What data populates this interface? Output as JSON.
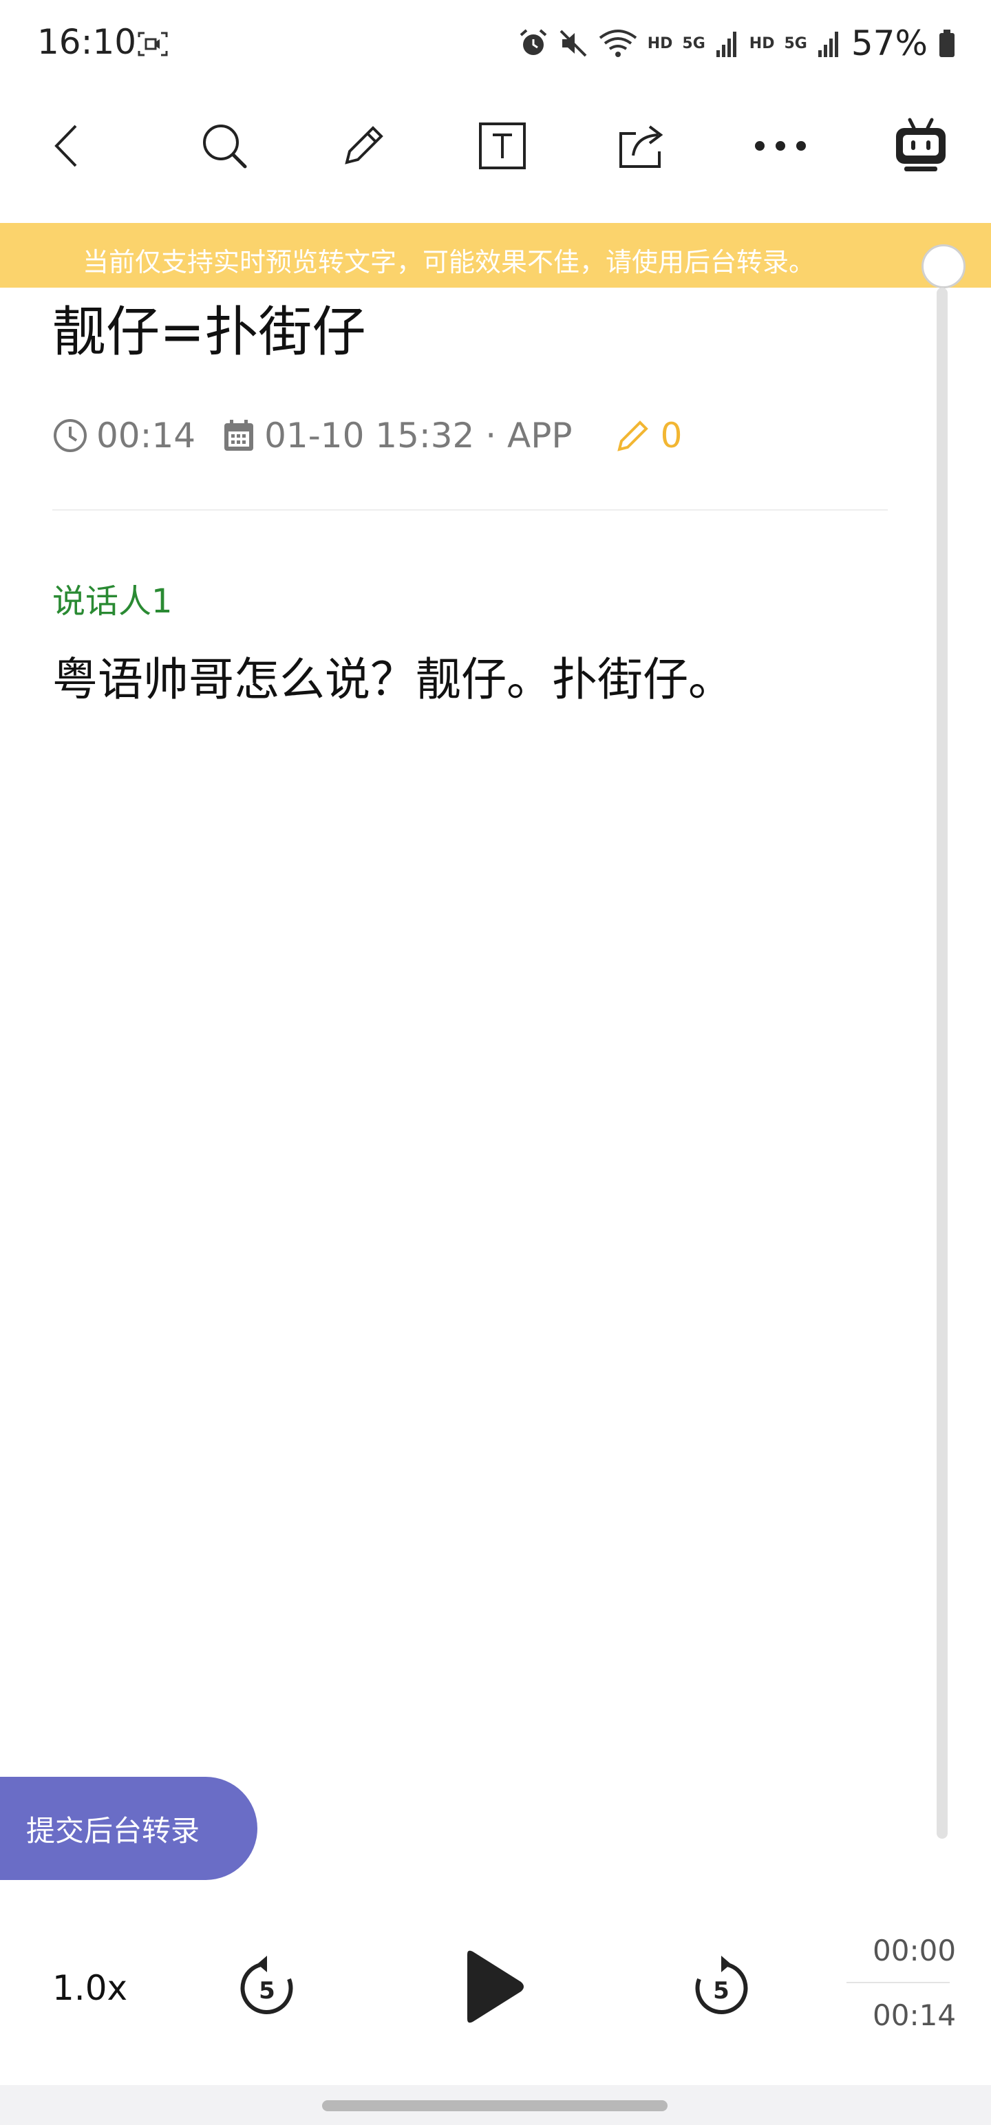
{
  "status_bar": {
    "time": "16:10",
    "labels": {
      "hd1": "HD",
      "net1": "5G",
      "hd2": "HD",
      "net2": "5G"
    },
    "battery": "57%"
  },
  "toolbar": {
    "icons": [
      "back-icon",
      "search-icon",
      "pencil-icon",
      "text-box-icon",
      "share-icon",
      "more-icon",
      "robot-icon"
    ]
  },
  "banner": {
    "text": "当前仅支持实时预览转文字，可能效果不佳，请使用后台转录。",
    "color": "#fbd36c"
  },
  "note": {
    "title": "靓仔=扑街仔",
    "duration": "00:14",
    "date_source": "01-10 15:32 · APP",
    "edit_count": "0"
  },
  "transcript": {
    "speaker": "说话人1",
    "text": "粤语帅哥怎么说？靓仔。扑街仔。"
  },
  "actions": {
    "submit_label": "提交后台转录"
  },
  "player": {
    "speed": "1.0x",
    "rewind_seconds": "5",
    "forward_seconds": "5",
    "current_time": "00:00",
    "total_time": "00:14"
  },
  "colors": {
    "speaker": "#2a8a33",
    "edit": "#f2b632",
    "submit": "#6a6dc6"
  }
}
